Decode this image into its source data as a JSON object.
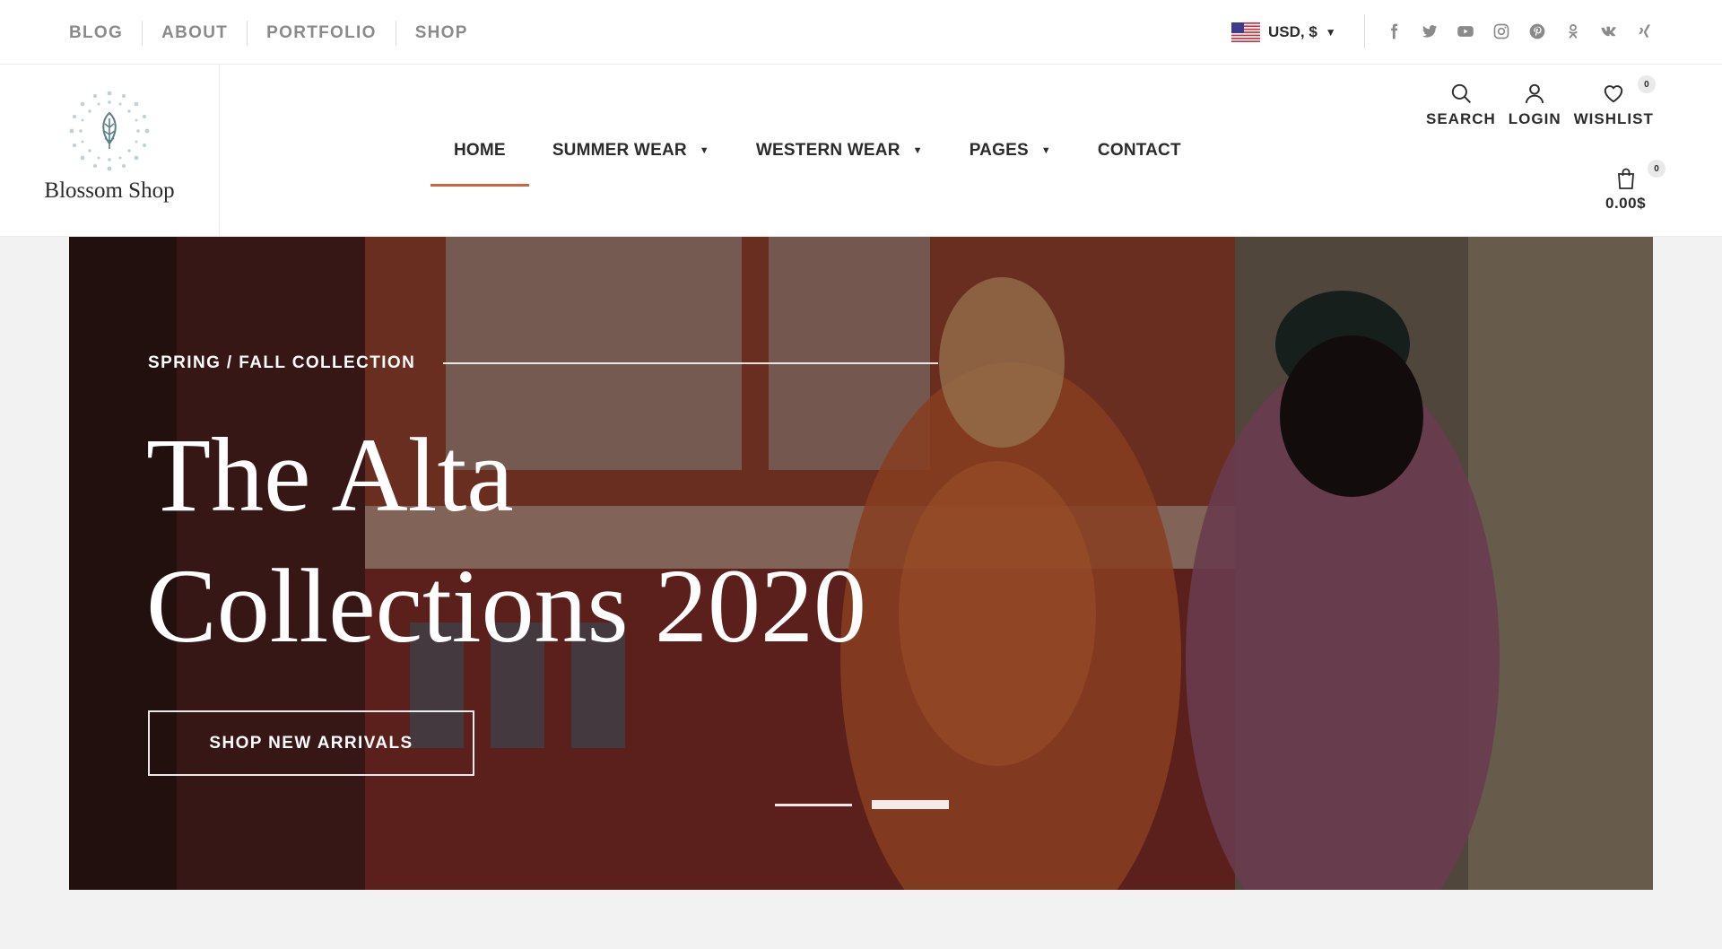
{
  "topbar": {
    "links": [
      "BLOG",
      "ABOUT",
      "PORTFOLIO",
      "SHOP"
    ],
    "currency": "USD, $",
    "socials": [
      "facebook-icon",
      "twitter-icon",
      "youtube-icon",
      "instagram-icon",
      "pinterest-icon",
      "odnoklassniki-icon",
      "vk-icon",
      "xing-icon"
    ]
  },
  "header": {
    "logo_text": "Blossom Shop",
    "nav": [
      {
        "label": "HOME",
        "active": true,
        "dropdown": false
      },
      {
        "label": "SUMMER WEAR",
        "active": false,
        "dropdown": true
      },
      {
        "label": "WESTERN WEAR",
        "active": false,
        "dropdown": true
      },
      {
        "label": "PAGES",
        "active": false,
        "dropdown": true
      },
      {
        "label": "CONTACT",
        "active": false,
        "dropdown": false
      }
    ],
    "icons": {
      "search_label": "SEARCH",
      "login_label": "LOGIN",
      "wishlist_label": "WISHLIST",
      "wishlist_count": "0",
      "cart_count": "0",
      "cart_total": "0.00$"
    },
    "accent_color": "#d0643b"
  },
  "hero": {
    "eyebrow": "SPRING / FALL COLLECTION",
    "title_line1": "The Alta",
    "title_line2": "Collections 2020",
    "button_label": "SHOP NEW ARRIVALS",
    "slides": 2,
    "active_slide": 2
  }
}
